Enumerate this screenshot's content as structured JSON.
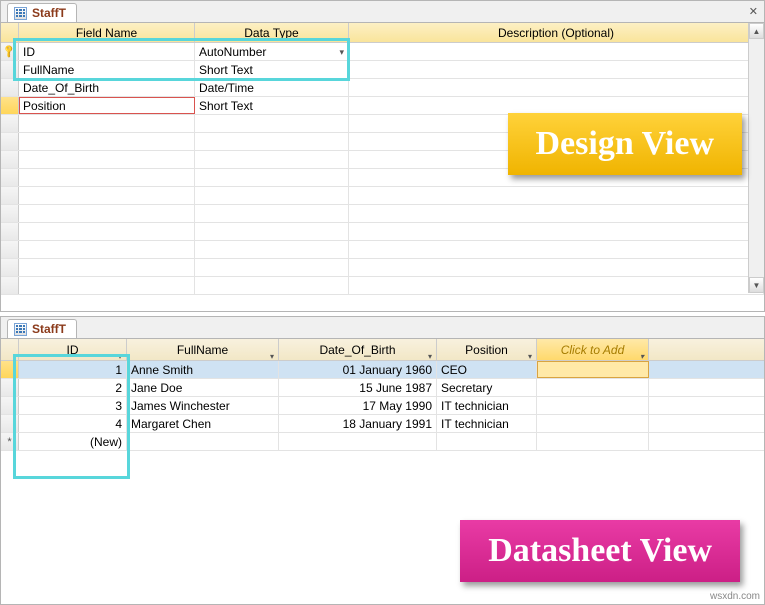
{
  "design_view": {
    "tab_title": "StaffT",
    "columns": {
      "field": "Field Name",
      "type": "Data Type",
      "desc": "Description (Optional)"
    },
    "fields": [
      {
        "name": "ID",
        "type": "AutoNumber",
        "pk": true,
        "active": false,
        "red_outline": false
      },
      {
        "name": "FullName",
        "type": "Short Text",
        "pk": false,
        "active": false,
        "red_outline": false
      },
      {
        "name": "Date_Of_Birth",
        "type": "Date/Time",
        "pk": false,
        "active": false,
        "red_outline": false
      },
      {
        "name": "Position",
        "type": "Short Text",
        "pk": false,
        "active": true,
        "red_outline": true
      }
    ],
    "badge": "Design View"
  },
  "datasheet_view": {
    "tab_title": "StaffT",
    "columns": {
      "id": "ID",
      "full": "FullName",
      "dob": "Date_Of_Birth",
      "pos": "Position",
      "add": "Click to Add"
    },
    "rows": [
      {
        "id": "1",
        "full": "Anne Smith",
        "dob": "01 January 1960",
        "pos": "CEO",
        "selected": true
      },
      {
        "id": "2",
        "full": "Jane Doe",
        "dob": "15 June 1987",
        "pos": "Secretary",
        "selected": false
      },
      {
        "id": "3",
        "full": "James Winchester",
        "dob": "17 May 1990",
        "pos": "IT technician",
        "selected": false
      },
      {
        "id": "4",
        "full": "Margaret Chen",
        "dob": "18 January 1991",
        "pos": "IT technician",
        "selected": false
      }
    ],
    "new_row_label": "(New)",
    "badge": "Datasheet View"
  },
  "watermark": "wsxdn.com",
  "chart_data": {
    "type": "table",
    "title": "StaffT",
    "columns": [
      "ID",
      "FullName",
      "Date_Of_Birth",
      "Position"
    ],
    "rows": [
      [
        1,
        "Anne Smith",
        "01 January 1960",
        "CEO"
      ],
      [
        2,
        "Jane Doe",
        "15 June 1987",
        "Secretary"
      ],
      [
        3,
        "James Winchester",
        "17 May 1990",
        "IT technician"
      ],
      [
        4,
        "Margaret Chen",
        "18 January 1991",
        "IT technician"
      ]
    ]
  }
}
